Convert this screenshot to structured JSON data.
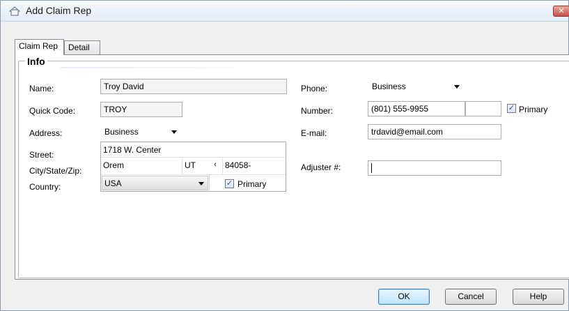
{
  "window": {
    "title": "Add Claim Rep",
    "close_label": "✕"
  },
  "tabs": [
    {
      "label": "Claim Rep"
    },
    {
      "label": "Detail"
    }
  ],
  "group": {
    "title": "Info"
  },
  "name": {
    "label": "Name:",
    "value": "Troy David"
  },
  "quick_code": {
    "label": "Quick Code:",
    "value": "TROY"
  },
  "address": {
    "label": "Address:",
    "type_value": "Business",
    "street_label": "Street:",
    "street_value": "1718 W. Center",
    "csz_label": "City/State/Zip:",
    "city_value": "Orem",
    "state_value": "UT",
    "state_arrow": "‹",
    "zip_value": "84058-",
    "country_label": "Country:",
    "country_value": "USA",
    "primary_label": "Primary",
    "primary_checked": "✓"
  },
  "phone": {
    "label": "Phone:",
    "type_value": "Business",
    "number_label": "Number:",
    "number_value": "(801)  555-9955",
    "primary_label": "Primary",
    "primary_checked": "✓"
  },
  "email": {
    "label": "E-mail:",
    "value": "trdavid@email.com"
  },
  "adjuster": {
    "label": "Adjuster #:",
    "value": ""
  },
  "buttons": {
    "ok": "OK",
    "cancel": "Cancel",
    "help": "Help"
  },
  "colors": {
    "accent": "#3c7fb1",
    "close": "#c75050"
  }
}
